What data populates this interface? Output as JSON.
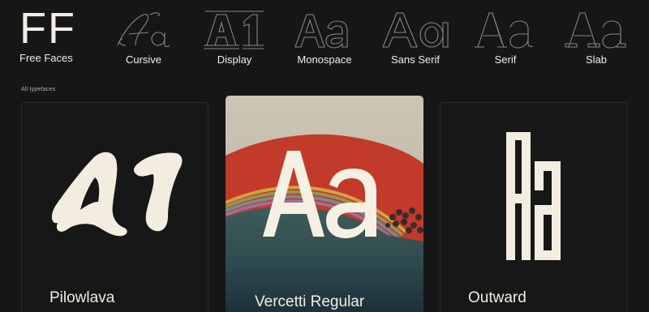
{
  "logo": {
    "mark": "FF",
    "label": "Free Faces"
  },
  "categories": [
    {
      "label": "Cursive",
      "icon": "cursive-glyph-icon"
    },
    {
      "label": "Display",
      "icon": "display-glyph-icon"
    },
    {
      "label": "Monospace",
      "icon": "monospace-glyph-icon"
    },
    {
      "label": "Sans Serif",
      "icon": "sans-serif-glyph-icon"
    },
    {
      "label": "Serif",
      "icon": "serif-glyph-icon"
    },
    {
      "label": "Slab",
      "icon": "slab-glyph-icon"
    }
  ],
  "section": {
    "label": "All typefaces"
  },
  "cards": [
    {
      "name": "Pilowlava",
      "specimen": "A1"
    },
    {
      "name": "Vercetti Regular",
      "specimen": "Aa"
    },
    {
      "name": "Outward",
      "specimen": "Aa"
    }
  ],
  "colors": {
    "background": "#161616",
    "text": "#f2ede2",
    "card_border": "#2c2c2c",
    "sun_red": "#c23a2a"
  }
}
